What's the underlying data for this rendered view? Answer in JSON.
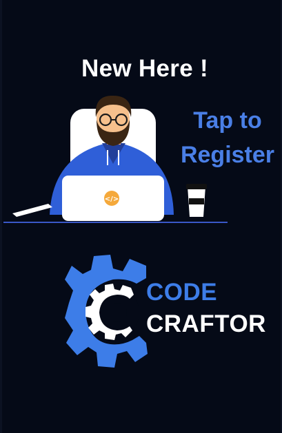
{
  "hero": {
    "headline": "New Here !"
  },
  "register": {
    "line1": "Tap to",
    "line2": "Register"
  },
  "brand": {
    "word1": "CODE",
    "word2": "CRAFTOR"
  },
  "icons": {
    "illustration": "developer-at-laptop-illustration",
    "laptop": "code-brackets-icon",
    "logo": "gear-c-logo-icon"
  },
  "colors": {
    "background": "#050a17",
    "accent": "#4a7fe6",
    "brand_blue": "#3d7de8",
    "hoodie": "#2f5fd8",
    "text": "#ffffff"
  }
}
